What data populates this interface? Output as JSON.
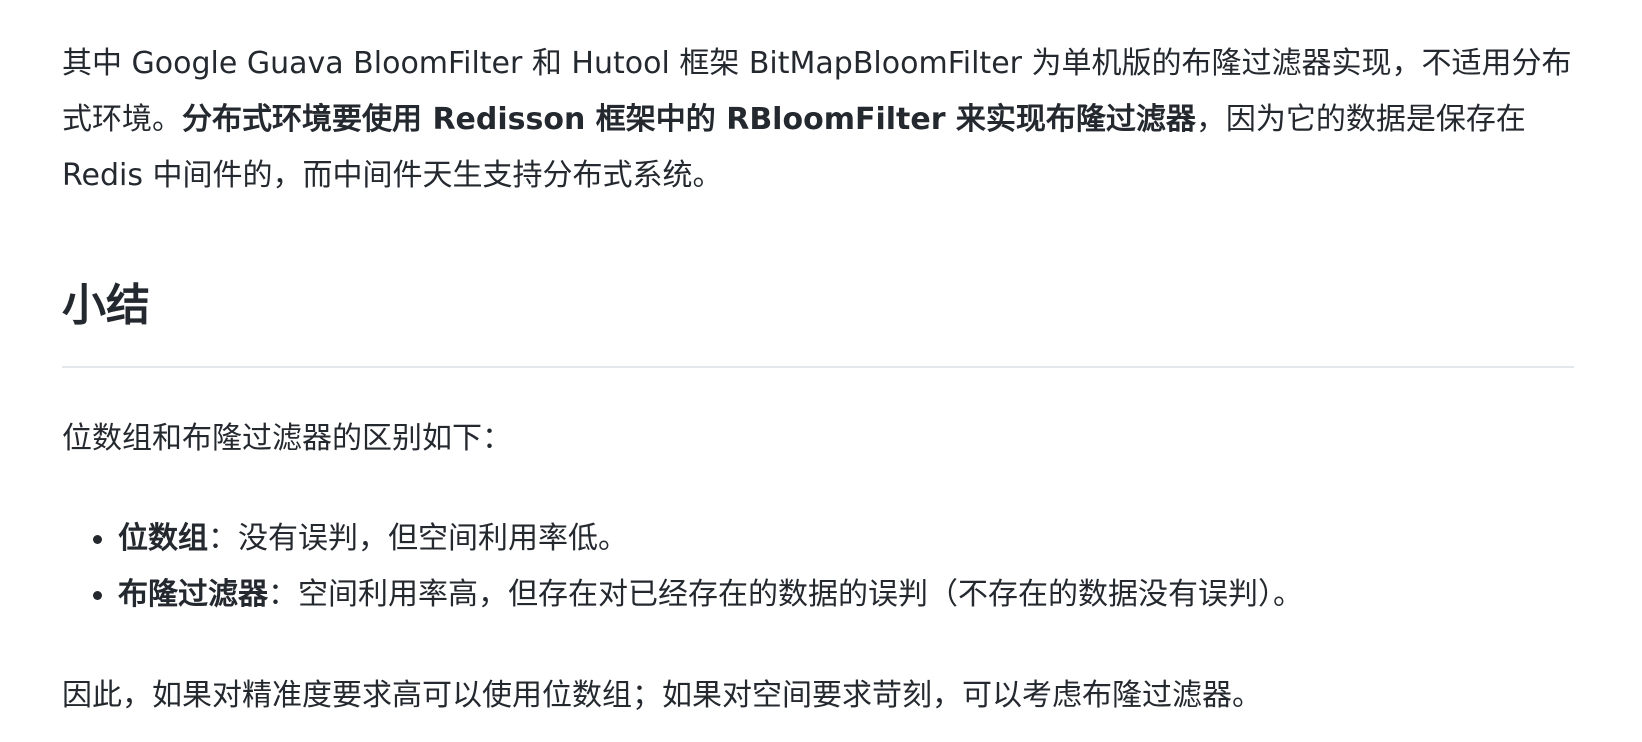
{
  "intro": {
    "part1": "其中 Google Guava BloomFilter 和 Hutool 框架 BitMapBloomFilter 为单机版的布隆过滤器实现，不适用分布式环境。",
    "bold": "分布式环境要使用 Redisson 框架中的 RBloomFilter 来实现布隆过滤器",
    "part2": "，因为它的数据是保存在 Redis 中间件的，而中间件天生支持分布式系统。"
  },
  "section": {
    "heading": "小结"
  },
  "diff_intro": "位数组和布隆过滤器的区别如下：",
  "bullets": [
    {
      "term": "位数组",
      "desc": "：没有误判，但空间利用率低。"
    },
    {
      "term": "布隆过滤器",
      "desc": "：空间利用率高，但存在对已经存在的数据的误判（不存在的数据没有误判）。"
    }
  ],
  "summary": "因此，如果对精准度要求高可以使用位数组；如果对空间要求苛刻，可以考虑布隆过滤器。"
}
